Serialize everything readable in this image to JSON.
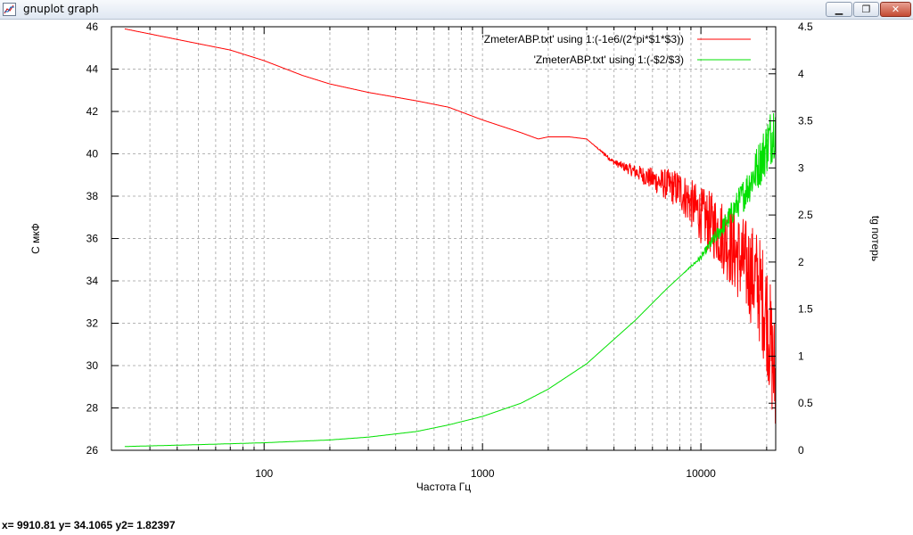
{
  "window": {
    "title": "gnuplot graph",
    "icon": "gnuplot-icon",
    "buttons": {
      "minimize": "▁",
      "maximize": "❐",
      "close": "✕"
    }
  },
  "status_bar": {
    "readout": "x= 9910.81 y= 34.1065 y2= 1.82397"
  },
  "chart_data": {
    "type": "line",
    "xlabel": "Частота Гц",
    "ylabel": "С мкФ",
    "y2label": "tg потерь",
    "x_scale": "log",
    "xlim": [
      20,
      22000
    ],
    "ylim": [
      26,
      46
    ],
    "y2lim": [
      0,
      4.5
    ],
    "grid": true,
    "legend_position": "top-right",
    "x_ticks": [
      "100",
      "1000",
      "10000"
    ],
    "y_ticks": [
      "26",
      "28",
      "30",
      "32",
      "34",
      "36",
      "38",
      "40",
      "42",
      "44",
      "46"
    ],
    "y2_ticks": [
      "0",
      "0.5",
      "1",
      "1.5",
      "2",
      "2.5",
      "3",
      "3.5",
      "4",
      "4.5"
    ],
    "series": [
      {
        "name": "'ZmeterABP.txt' using 1:(-1e6/(2*pi*$1*$3))",
        "axis": "y",
        "color": "#ff0000",
        "x": [
          23,
          40,
          70,
          100,
          150,
          200,
          300,
          500,
          700,
          1000,
          1500,
          1800,
          2000,
          2500,
          3000,
          4000,
          6000,
          8000,
          10000,
          12000,
          15000,
          18000,
          20000,
          22000
        ],
        "y": [
          45.9,
          45.4,
          44.9,
          44.4,
          43.7,
          43.3,
          42.9,
          42.5,
          42.2,
          41.6,
          41.0,
          40.7,
          40.8,
          40.8,
          40.7,
          39.6,
          38.8,
          38.3,
          37.1,
          36.4,
          35.1,
          34.0,
          32.5,
          29.0
        ],
        "noise_start": 3000,
        "noise_amplitude_end": 3.0
      },
      {
        "name": "'ZmeterABP.txt' using 1:(-$2/$3)",
        "axis": "y2",
        "color": "#00e000",
        "x": [
          23,
          50,
          100,
          200,
          300,
          500,
          700,
          1000,
          1500,
          2000,
          3000,
          5000,
          7000,
          10000,
          13000,
          16000,
          19000,
          21000,
          22000
        ],
        "y": [
          0.04,
          0.06,
          0.08,
          0.11,
          0.14,
          0.2,
          0.27,
          0.36,
          0.5,
          0.65,
          0.92,
          1.38,
          1.72,
          2.05,
          2.42,
          2.75,
          3.1,
          3.35,
          3.5
        ],
        "noise_start": 8000,
        "noise_amplitude_end": 0.35
      }
    ]
  }
}
